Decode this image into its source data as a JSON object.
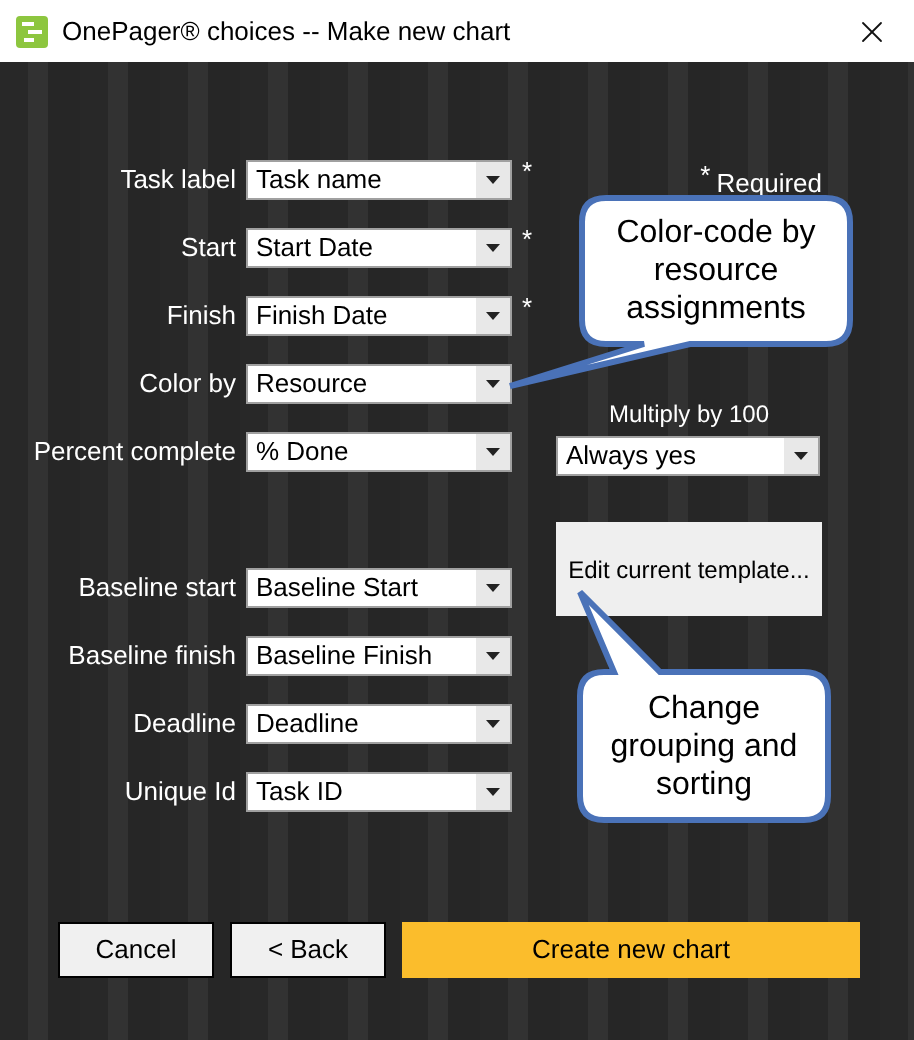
{
  "window": {
    "title": "OnePager® choices -- Make new chart"
  },
  "fields": [
    {
      "label": "Task label",
      "value": "Task name",
      "required": true
    },
    {
      "label": "Start",
      "value": "Start Date",
      "required": true
    },
    {
      "label": "Finish",
      "value": "Finish Date",
      "required": true
    },
    {
      "label": "Color by",
      "value": "Resource",
      "required": false
    },
    {
      "label": "Percent complete",
      "value": "% Done",
      "required": false
    },
    {
      "label": "Baseline start",
      "value": "Baseline Start",
      "required": false
    },
    {
      "label": "Baseline finish",
      "value": "Baseline Finish",
      "required": false
    },
    {
      "label": "Deadline",
      "value": "Deadline",
      "required": false
    },
    {
      "label": "Unique Id",
      "value": "Task ID",
      "required": false
    }
  ],
  "required_note": {
    "mark": "*",
    "text": "Required"
  },
  "multiply": {
    "label": "Multiply by 100",
    "value": "Always yes"
  },
  "edit_template_button": "Edit current template...",
  "callouts": [
    "Color-code by resource assignments",
    "Change grouping and sorting"
  ],
  "buttons": [
    {
      "label": "Cancel",
      "kind": "plain"
    },
    {
      "label": "< Back",
      "kind": "plain"
    },
    {
      "label": "Create new chart",
      "kind": "primary"
    }
  ]
}
